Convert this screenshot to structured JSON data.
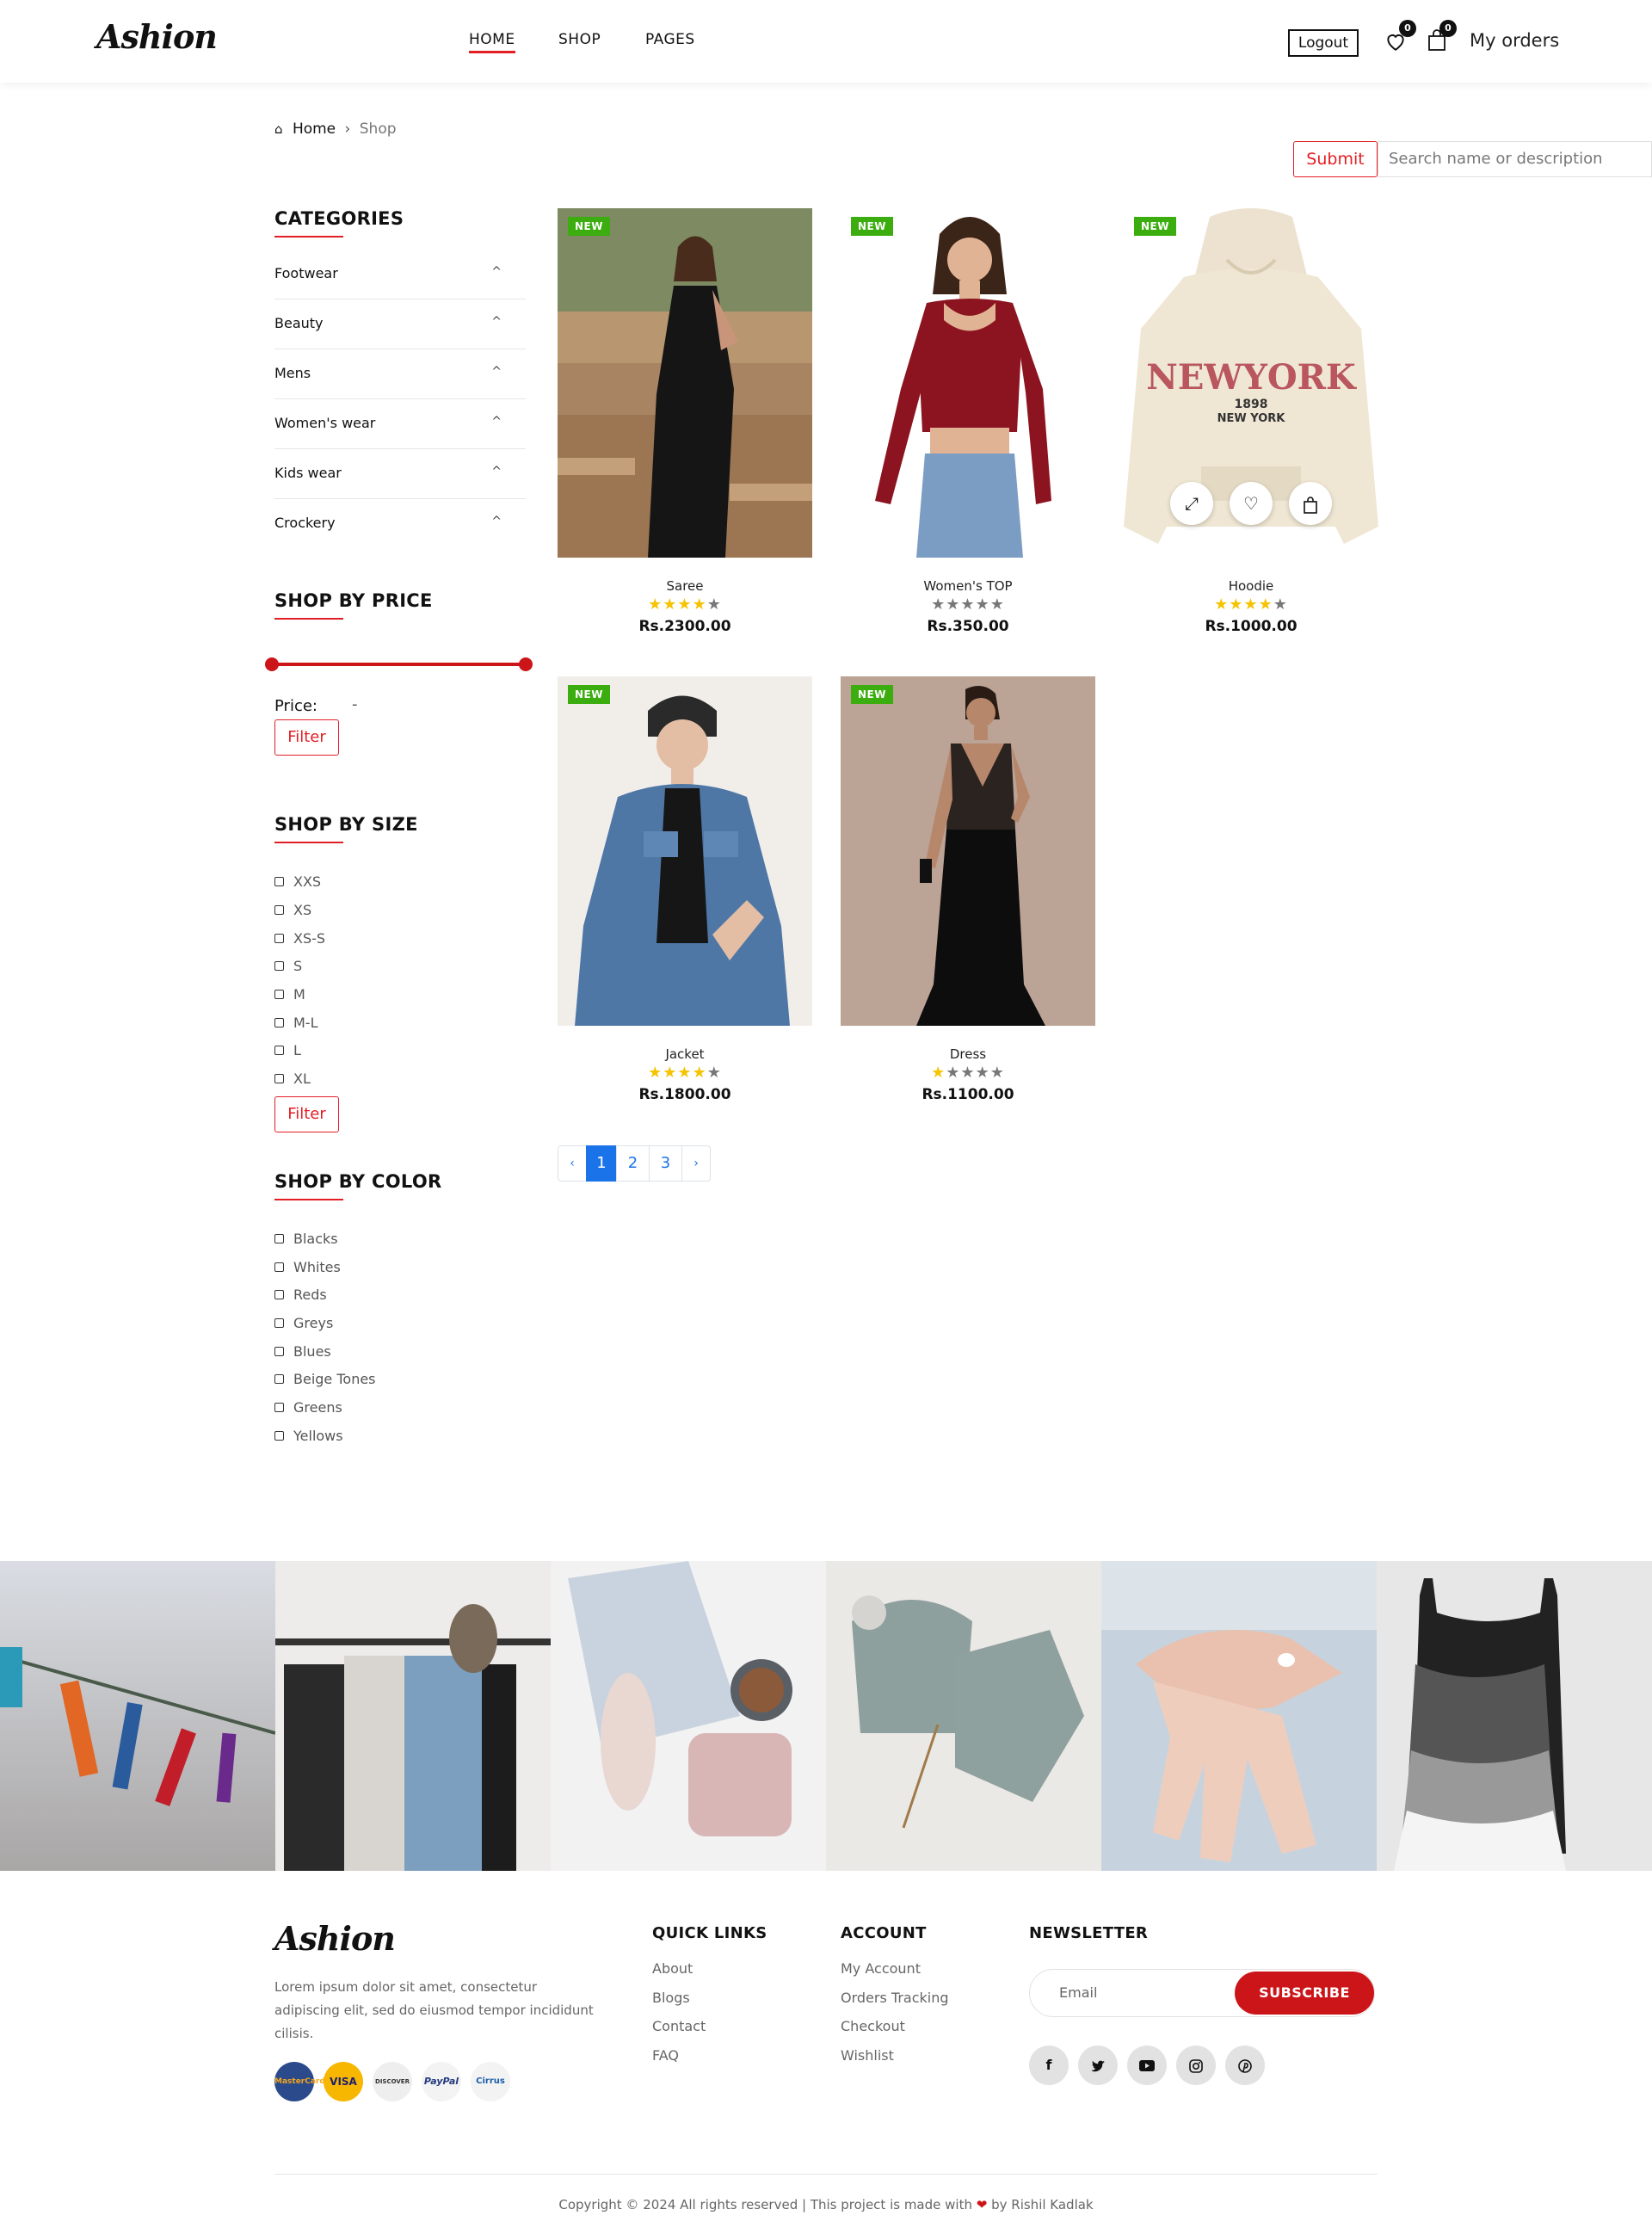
{
  "header": {
    "logo": "Ashion",
    "nav": [
      "HOME",
      "SHOP",
      "PAGES"
    ],
    "logout": "Logout",
    "wishlist_count": "0",
    "cart_count": "0",
    "my_orders": "My orders"
  },
  "breadcrumb": {
    "home": "Home",
    "current": "Shop"
  },
  "search": {
    "submit": "Submit",
    "placeholder": "Search name or description"
  },
  "sidebar": {
    "categories_title": "CATEGORIES",
    "categories": [
      "Footwear",
      "Beauty",
      "Mens",
      "Women's wear",
      "Kids wear",
      "Crockery"
    ],
    "price_title": "SHOP BY PRICE",
    "price_label": "Price:",
    "price_sep": "-",
    "filter": "Filter",
    "size_title": "SHOP BY SIZE",
    "sizes": [
      "XXS",
      "XS",
      "XS-S",
      "S",
      "M",
      "M-L",
      "L",
      "XL"
    ],
    "color_title": "SHOP BY COLOR",
    "colors": [
      "Blacks",
      "Whites",
      "Reds",
      "Greys",
      "Blues",
      "Beige Tones",
      "Greens",
      "Yellows"
    ]
  },
  "products": [
    {
      "badge": "NEW",
      "name": "Saree",
      "rating": 4,
      "price": "Rs.2300.00"
    },
    {
      "badge": "NEW",
      "name": "Women's TOP",
      "rating": 0,
      "price": "Rs.350.00"
    },
    {
      "badge": "NEW",
      "name": "Hoodie",
      "rating": 4,
      "price": "Rs.1000.00",
      "hoodie_text1": "NEWYORK",
      "hoodie_text2": "1898",
      "hoodie_text3": "NEW YORK"
    },
    {
      "badge": "NEW",
      "name": "Jacket",
      "rating": 4,
      "price": "Rs.1800.00"
    },
    {
      "badge": "NEW",
      "name": "Dress",
      "rating": 1,
      "price": "Rs.1100.00"
    }
  ],
  "pagination": {
    "prev": "‹",
    "pages": [
      "1",
      "2",
      "3"
    ],
    "next": "›",
    "active": "1"
  },
  "footer": {
    "logo": "Ashion",
    "about_text_1": "Lorem ipsum dolor sit amet, consectetur",
    "about_text_2": "adipiscing elit, sed do eiusmod tempor incididunt",
    "about_text_3": "cilisis.",
    "payment_cards": [
      "MasterCard",
      "VISA",
      "DISCOVER",
      "PayPal",
      "Cirrus"
    ],
    "quick_links_title": "QUICK LINKS",
    "quick_links": [
      "About",
      "Blogs",
      "Contact",
      "FAQ"
    ],
    "account_title": "ACCOUNT",
    "account_links": [
      "My Account",
      "Orders Tracking",
      "Checkout",
      "Wishlist"
    ],
    "newsletter_title": "NEWSLETTER",
    "email_placeholder": "Email",
    "subscribe": "SUBSCRIBE",
    "socials": [
      "facebook-icon",
      "twitter-icon",
      "youtube-icon",
      "instagram-icon",
      "pinterest-icon"
    ],
    "copyright_pre": "Copyright © 2024 All rights reserved | This project is made with",
    "copyright_post": "by Rishil Kadlak"
  },
  "colors": {
    "accent": "#e31e24",
    "new_badge": "#3bad0f",
    "star": "#f6c300",
    "page_active": "#1a73e8"
  }
}
